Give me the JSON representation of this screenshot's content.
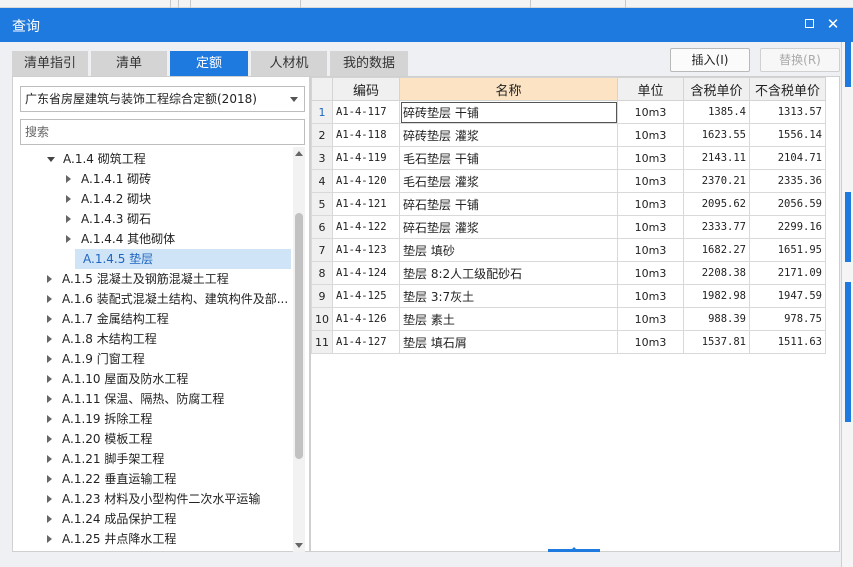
{
  "window": {
    "title": "查询"
  },
  "tabs": [
    {
      "label": "清单指引",
      "active": false
    },
    {
      "label": "清单",
      "active": false
    },
    {
      "label": "定额",
      "active": true
    },
    {
      "label": "人材机",
      "active": false
    },
    {
      "label": "我的数据",
      "active": false
    }
  ],
  "buttons": {
    "insert": "插入(I)",
    "replace": "替换(R)"
  },
  "library": {
    "selected": "广东省房屋建筑与装饰工程综合定额(2018)"
  },
  "search": {
    "placeholder": "搜索"
  },
  "tree": [
    {
      "label": "A.1.4 砌筑工程",
      "level": 1,
      "state": "expanded"
    },
    {
      "label": "A.1.4.1 砌砖",
      "level": 2,
      "state": "collapsed"
    },
    {
      "label": "A.1.4.2 砌块",
      "level": 2,
      "state": "collapsed"
    },
    {
      "label": "A.1.4.3 砌石",
      "level": 2,
      "state": "collapsed"
    },
    {
      "label": "A.1.4.4 其他砌体",
      "level": 2,
      "state": "collapsed"
    },
    {
      "label": "A.1.4.5 垫层",
      "level": 2,
      "state": "leaf",
      "selected": true
    },
    {
      "label": "A.1.5 混凝土及钢筋混凝土工程",
      "level": 1,
      "state": "collapsed"
    },
    {
      "label": "A.1.6 装配式混凝土结构、建筑构件及部...",
      "level": 1,
      "state": "collapsed"
    },
    {
      "label": "A.1.7 金属结构工程",
      "level": 1,
      "state": "collapsed"
    },
    {
      "label": "A.1.8 木结构工程",
      "level": 1,
      "state": "collapsed"
    },
    {
      "label": "A.1.9 门窗工程",
      "level": 1,
      "state": "collapsed"
    },
    {
      "label": "A.1.10 屋面及防水工程",
      "level": 1,
      "state": "collapsed"
    },
    {
      "label": "A.1.11 保温、隔热、防腐工程",
      "level": 1,
      "state": "collapsed"
    },
    {
      "label": "A.1.19 拆除工程",
      "level": 1,
      "state": "collapsed"
    },
    {
      "label": "A.1.20 模板工程",
      "level": 1,
      "state": "collapsed"
    },
    {
      "label": "A.1.21 脚手架工程",
      "level": 1,
      "state": "collapsed"
    },
    {
      "label": "A.1.22 垂直运输工程",
      "level": 1,
      "state": "collapsed"
    },
    {
      "label": "A.1.23 材料及小型构件二次水平运输",
      "level": 1,
      "state": "collapsed"
    },
    {
      "label": "A.1.24 成品保护工程",
      "level": 1,
      "state": "collapsed"
    },
    {
      "label": "A.1.25 井点降水工程",
      "level": 1,
      "state": "collapsed"
    }
  ],
  "grid": {
    "headers": {
      "code": "编码",
      "name": "名称",
      "unit": "单位",
      "tax_price": "含税单价",
      "notax_price": "不含税单价"
    },
    "rows": [
      {
        "n": "1",
        "code": "A1-4-117",
        "name": "碎砖垫层 干铺",
        "unit": "10m3",
        "tax": "1385.4",
        "notax": "1313.57"
      },
      {
        "n": "2",
        "code": "A1-4-118",
        "name": "碎砖垫层 灌浆",
        "unit": "10m3",
        "tax": "1623.55",
        "notax": "1556.14"
      },
      {
        "n": "3",
        "code": "A1-4-119",
        "name": "毛石垫层 干铺",
        "unit": "10m3",
        "tax": "2143.11",
        "notax": "2104.71"
      },
      {
        "n": "4",
        "code": "A1-4-120",
        "name": "毛石垫层 灌浆",
        "unit": "10m3",
        "tax": "2370.21",
        "notax": "2335.36"
      },
      {
        "n": "5",
        "code": "A1-4-121",
        "name": "碎石垫层 干铺",
        "unit": "10m3",
        "tax": "2095.62",
        "notax": "2056.59"
      },
      {
        "n": "6",
        "code": "A1-4-122",
        "name": "碎石垫层 灌浆",
        "unit": "10m3",
        "tax": "2333.77",
        "notax": "2299.16"
      },
      {
        "n": "7",
        "code": "A1-4-123",
        "name": "垫层 填砂",
        "unit": "10m3",
        "tax": "1682.27",
        "notax": "1651.95"
      },
      {
        "n": "8",
        "code": "A1-4-124",
        "name": "垫层 8:2人工级配砂石",
        "unit": "10m3",
        "tax": "2208.38",
        "notax": "2171.09"
      },
      {
        "n": "9",
        "code": "A1-4-125",
        "name": "垫层 3:7灰土",
        "unit": "10m3",
        "tax": "1982.98",
        "notax": "1947.59"
      },
      {
        "n": "10",
        "code": "A1-4-126",
        "name": "垫层 素土",
        "unit": "10m3",
        "tax": "988.39",
        "notax": "978.75"
      },
      {
        "n": "11",
        "code": "A1-4-127",
        "name": "垫层 填石屑",
        "unit": "10m3",
        "tax": "1537.81",
        "notax": "1511.63"
      }
    ]
  },
  "colors": {
    "accent": "#1f7ae0",
    "name_header": "#fbe3c3",
    "selected_row": "#cfe4f7"
  }
}
